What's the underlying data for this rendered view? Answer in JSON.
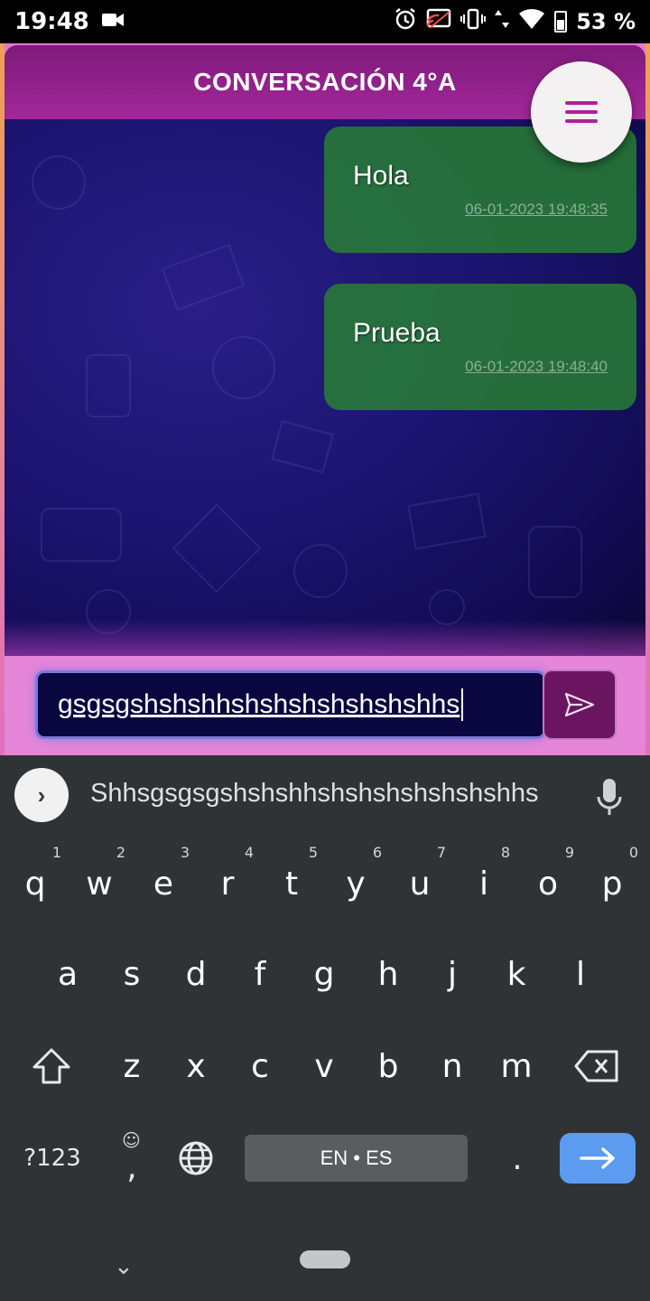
{
  "status_bar": {
    "time": "19:48",
    "battery": "53 %",
    "icons": [
      "video-camera-icon",
      "alarm-icon",
      "cast-icon",
      "vibrate-icon",
      "data-arrows-icon",
      "wifi-icon",
      "battery-icon"
    ]
  },
  "header": {
    "title": "CONVERSACIÓN 4°A",
    "menu_icon": "hamburger-menu-icon",
    "brand_color": "#9c2590"
  },
  "messages": [
    {
      "text": "Hola",
      "timestamp": "06-01-2023 19:48:35"
    },
    {
      "text": "Prueba",
      "timestamp": "06-01-2023 19:48:40"
    }
  ],
  "composer": {
    "value": "gsgsgshshshhshshshshshshshhs",
    "send_icon": "send-icon"
  },
  "keyboard": {
    "suggestion": "Shhsgsgsgshshshhshshshshshshshhs",
    "row1": [
      {
        "k": "q",
        "h": "1"
      },
      {
        "k": "w",
        "h": "2"
      },
      {
        "k": "e",
        "h": "3"
      },
      {
        "k": "r",
        "h": "4"
      },
      {
        "k": "t",
        "h": "5"
      },
      {
        "k": "y",
        "h": "6"
      },
      {
        "k": "u",
        "h": "7"
      },
      {
        "k": "i",
        "h": "8"
      },
      {
        "k": "o",
        "h": "9"
      },
      {
        "k": "p",
        "h": "0"
      }
    ],
    "row2": [
      "a",
      "s",
      "d",
      "f",
      "g",
      "h",
      "j",
      "k",
      "l"
    ],
    "row3": [
      "z",
      "x",
      "c",
      "v",
      "b",
      "n",
      "m"
    ],
    "symbols_label": "?123",
    "comma_label": ",",
    "period_label": ".",
    "space_label": "EN • ES",
    "enter_color": "#5b9bf0"
  }
}
